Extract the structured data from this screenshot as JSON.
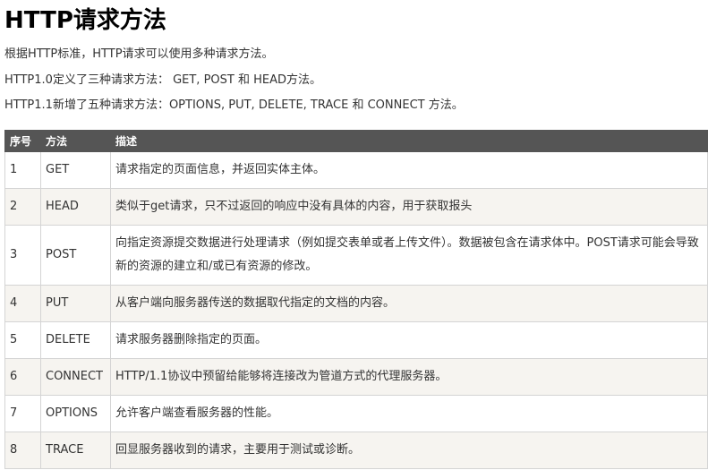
{
  "title": "HTTP请求方法",
  "paragraphs": {
    "p1": "根据HTTP标准，HTTP请求可以使用多种请求方法。",
    "p2": "HTTP1.0定义了三种请求方法： GET, POST 和 HEAD方法。",
    "p3": "HTTP1.1新增了五种请求方法：OPTIONS, PUT, DELETE, TRACE 和 CONNECT 方法。"
  },
  "table": {
    "headers": [
      "序号",
      "方法",
      "描述"
    ],
    "rows": [
      {
        "num": "1",
        "method": "GET",
        "desc": "请求指定的页面信息，并返回实体主体。"
      },
      {
        "num": "2",
        "method": "HEAD",
        "desc": "类似于get请求，只不过返回的响应中没有具体的内容，用于获取报头"
      },
      {
        "num": "3",
        "method": "POST",
        "desc": "向指定资源提交数据进行处理请求（例如提交表单或者上传文件）。数据被包含在请求体中。POST请求可能会导致新的资源的建立和/或已有资源的修改。"
      },
      {
        "num": "4",
        "method": "PUT",
        "desc": "从客户端向服务器传送的数据取代指定的文档的内容。"
      },
      {
        "num": "5",
        "method": "DELETE",
        "desc": "请求服务器删除指定的页面。"
      },
      {
        "num": "6",
        "method": "CONNECT",
        "desc": "HTTP/1.1协议中预留给能够将连接改为管道方式的代理服务器。"
      },
      {
        "num": "7",
        "method": "OPTIONS",
        "desc": "允许客户端查看服务器的性能。"
      },
      {
        "num": "8",
        "method": "TRACE",
        "desc": "回显服务器收到的请求，主要用于测试或诊断。"
      }
    ]
  }
}
